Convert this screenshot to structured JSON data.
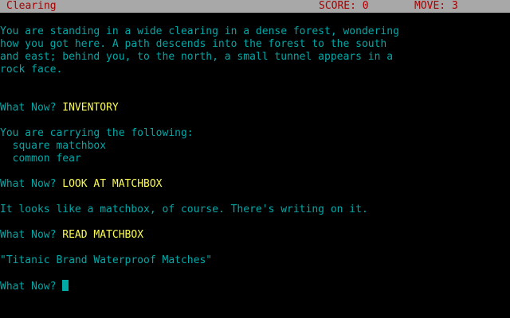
{
  "status": {
    "location": "Clearing",
    "score": "SCORE: 0",
    "move": "MOVE: 3"
  },
  "transcript": {
    "intro": [
      "You are standing in a wide clearing in a dense forest, wondering",
      "how you got here. A path descends into the forest to the south",
      "and east; behind you, to the north, a small tunnel appears in a",
      "rock face."
    ],
    "prompt": "What Now? ",
    "command1": "INVENTORY",
    "inventory_header": "You are carrying the following:",
    "inventory_items": [
      "  square matchbox",
      "  common fear"
    ],
    "command2": "LOOK AT MATCHBOX",
    "response2": "It looks like a matchbox, of course. There's writing on it.",
    "command3": "READ MATCHBOX",
    "response3": "\"Titanic Brand Waterproof Matches\""
  },
  "colors": {
    "background": "#000000",
    "status_bar": "#a8a8a8",
    "status_text": "#a80000",
    "text": "#00a8a8",
    "command": "#fcfc54"
  }
}
